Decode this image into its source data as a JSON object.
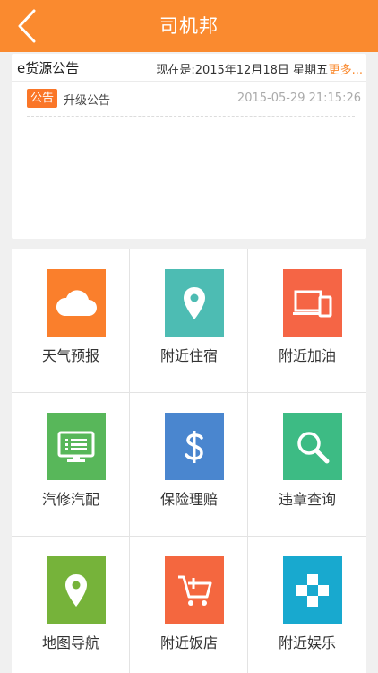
{
  "header": {
    "title": "司机邦"
  },
  "notice": {
    "title": "e货源公告",
    "date_text": "现在是:2015年12月18日 星期五",
    "more_label": "更多...",
    "items": [
      {
        "badge": "公告",
        "title": "升级公告",
        "time": "2015-05-29 21:15:26"
      }
    ]
  },
  "grid": {
    "items": [
      {
        "label": "天气预报",
        "icon": "cloud-icon",
        "color": "#fa7f2c"
      },
      {
        "label": "附近住宿",
        "icon": "location-pin-icon",
        "color": "#4dbcb3"
      },
      {
        "label": "附近加油",
        "icon": "devices-icon",
        "color": "#f56545"
      },
      {
        "label": "汽修汽配",
        "icon": "monitor-list-icon",
        "color": "#58b75a"
      },
      {
        "label": "保险理赔",
        "icon": "dollar-icon",
        "color": "#4a86cf"
      },
      {
        "label": "违章查询",
        "icon": "magnifier-icon",
        "color": "#3dbb84"
      },
      {
        "label": "地图导航",
        "icon": "map-pin-icon",
        "color": "#76b33a"
      },
      {
        "label": "附近饭店",
        "icon": "cart-add-icon",
        "color": "#f4673f"
      },
      {
        "label": "附近娱乐",
        "icon": "gamepad-icon",
        "color": "#18a9cf"
      }
    ]
  }
}
